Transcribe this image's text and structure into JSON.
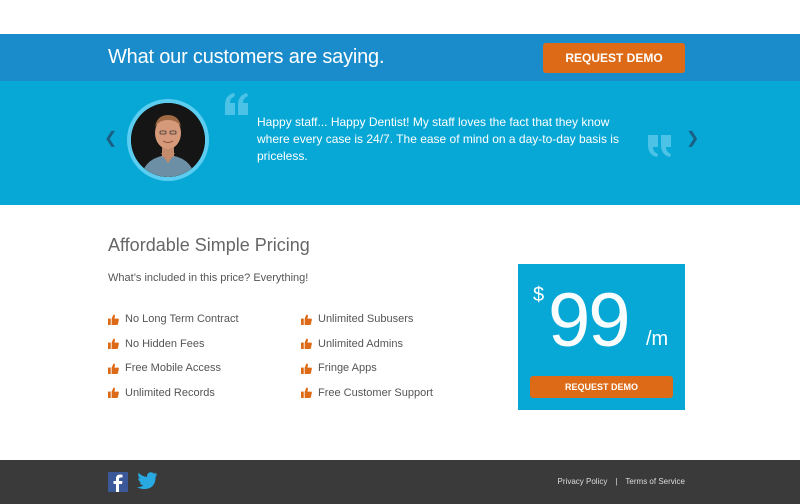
{
  "banner": {
    "title": "What our customers are saying.",
    "button_label": "REQUEST DEMO"
  },
  "testimonial": {
    "quote": "Happy staff... Happy Dentist! My staff loves the fact that they know where every case is 24/7. The ease of mind on a day-to-day basis is priceless.",
    "prev_icon": "chevron-left-icon",
    "next_icon": "chevron-right-icon"
  },
  "pricing": {
    "title": "Affordable Simple Pricing",
    "subtitle": "What’s included in this price? Everything!",
    "features_left": [
      "No Long Term Contract",
      "No Hidden Fees",
      "Free Mobile Access",
      "Unlimited Records"
    ],
    "features_right": [
      "Unlimited Subusers",
      "Unlimited Admins",
      "Fringe Apps",
      "Free Customer Support"
    ],
    "price": {
      "currency": "$",
      "amount": "99",
      "period": "/m",
      "button_label": "REQUEST DEMO"
    }
  },
  "footer": {
    "privacy": "Privacy Policy",
    "separator": "|",
    "terms": "Terms of Service"
  },
  "colors": {
    "banner_blue": "#1a8ccc",
    "light_blue": "#07a8d6",
    "orange": "#dd6a16",
    "footer_dark": "#3a3a3a"
  }
}
